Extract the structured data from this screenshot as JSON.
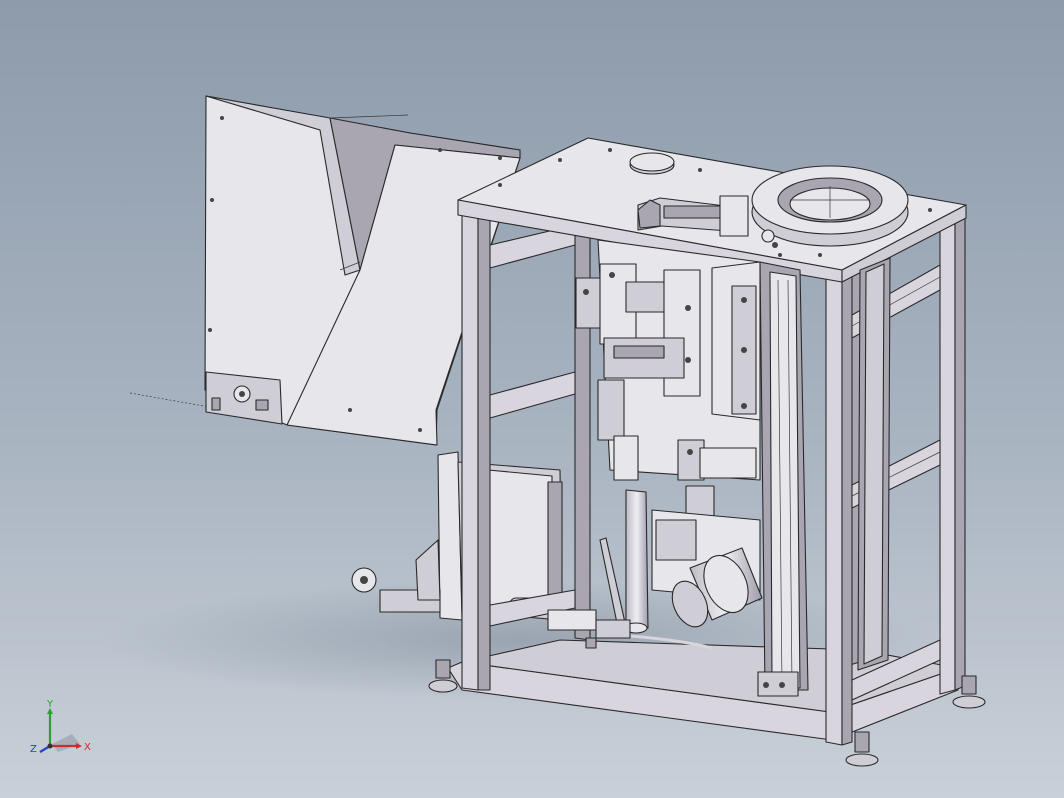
{
  "viewport": {
    "background_top": "#8d9bab",
    "background_bottom": "#c9d0d8"
  },
  "model": {
    "part_fill": "#d8d5de",
    "edge_color": "#2a2a2a"
  },
  "triad": {
    "x_label": "X",
    "y_label": "Y",
    "z_label": "Z",
    "x_color": "#d12a2a",
    "y_color": "#2ca02c",
    "z_color": "#2440c8"
  }
}
